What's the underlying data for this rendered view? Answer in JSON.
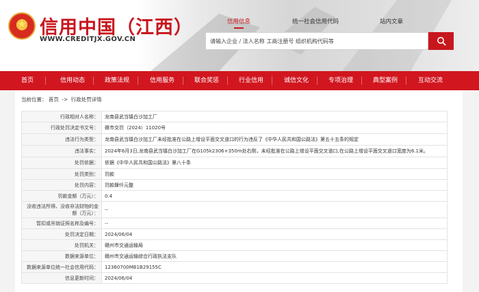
{
  "header": {
    "title": "信用中国（江西）",
    "url": "WWW.CREDITJX.GOV.CN",
    "top_tabs": [
      "信用信息",
      "统一社会信用代码",
      "站内文章"
    ],
    "active_tab": 0,
    "search_placeholder": "请输入企业 / 法人名称 工商注册号 组织机构代码等"
  },
  "nav": {
    "items": [
      "首页",
      "信用动态",
      "政策法规",
      "信用服务",
      "联合奖惩",
      "行业信用",
      "诚信文化",
      "专项治理",
      "典型案例",
      "互动交流"
    ]
  },
  "breadcrumb": {
    "label": "当前位置：",
    "home": "首页",
    "separator": "->",
    "current": "行政处罚详情"
  },
  "detail": {
    "rows": [
      {
        "key": "行政相对人名称：",
        "value": "龙南县武当镇白沙加工厂"
      },
      {
        "key": "行政处罚决定书文号：",
        "value": "赣市交罚（2024）11020号"
      },
      {
        "key": "违法行为类型：",
        "value": "龙南县武当镇白沙加工厂未经批准在公路上增设平面交叉道口的行为违反了《中华人民共和国公路法》第五十五条的规定"
      },
      {
        "key": "违法事实：",
        "value": "2024年6月3日,龙南县武当镇白沙加工厂在G105k2306+350m处右侧，未经批准在公路上增设平面交叉道口,在公路上增设平面交叉道口宽度为6.1米。"
      },
      {
        "key": "处罚依据：",
        "value": "依据《中华人民共和国公路法》第八十条"
      },
      {
        "key": "处罚类别：",
        "value": "罚款"
      },
      {
        "key": "处罚内容：",
        "value": "罚款肆仟元整"
      },
      {
        "key": "罚款金额（万元）：",
        "value": "0.4"
      },
      {
        "key": "没收违法所得、没收非法财物的金额（万元）：",
        "value": "--"
      },
      {
        "key": "暂扣或吊销证照名称及编号：",
        "value": "--"
      },
      {
        "key": "处罚决定日期：",
        "value": "2024/06/04"
      },
      {
        "key": "处罚机关：",
        "value": "赣州市交通运输局"
      },
      {
        "key": "数据来源单位：",
        "value": "赣州市交通运输综合行政执法支队"
      },
      {
        "key": "数据来源单位统一社会信用代码：",
        "value": "12360700MB1B29155C"
      },
      {
        "key": "信息更新时间：",
        "value": "2024/06/04"
      }
    ]
  },
  "colors": {
    "brand_red": "#c8161d",
    "nav_red": "#d1161f",
    "label_bg": "#f6f6f6",
    "border": "#e3e3e3"
  },
  "icons": {
    "logo": "national-emblem",
    "search": "search-icon"
  }
}
